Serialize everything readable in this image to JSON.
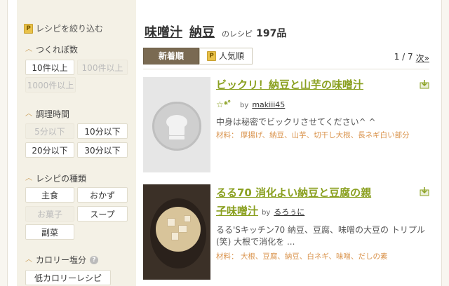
{
  "sidebar": {
    "filter_title": "レシピを絞り込む",
    "tsukurepo": {
      "title": "つくれぽ数",
      "options": [
        "10件以上",
        "100件以上",
        "1000件以上"
      ]
    },
    "time": {
      "title": "調理時間",
      "options": [
        "5分以下",
        "10分以下",
        "20分以下",
        "30分以下"
      ]
    },
    "kind": {
      "title": "レシピの種類",
      "options": [
        "主食",
        "おかず",
        "お菓子",
        "スープ",
        "副菜"
      ]
    },
    "calorie": {
      "title": "カロリー塩分",
      "options": [
        "低カロリーレシピ"
      ]
    }
  },
  "main": {
    "keyword_1": "味噌汁",
    "keyword_2": "納豆",
    "count_label": "のレシピ",
    "count": "197品",
    "sort_new": "新着順",
    "sort_popular": "人気順",
    "page_info": "1 / 7",
    "next_label": "次»"
  },
  "recipes": [
    {
      "title": "ビックリ！納豆と山芋の味噌汁",
      "stars": "☆*゜",
      "by": "by",
      "author": "makiii45",
      "description": "中身は秘密でビックリさせてください^ ^",
      "ingredients": "材料： 厚揚げ、納豆、山芋、切干し大根、長ネギ白い部分"
    },
    {
      "title_line1": "るる70 消化よい納豆と豆腐の親",
      "title_line2": "子味噌汁",
      "by": "by",
      "author": "るろぅに",
      "description": "るる'Sキッチン70 納豆、豆腐、味噌の大豆の トリプル(笑) 大根で消化を ...",
      "ingredients": "材料： 大根、豆腐、納豆、白ネギ、味噌、だしの素"
    }
  ],
  "colors": {
    "title_green": "#8aa020",
    "ingredient_orange": "#d9924a",
    "sort_active_bg": "#7a6a52",
    "sidebar_bg": "#f4f1e6"
  }
}
